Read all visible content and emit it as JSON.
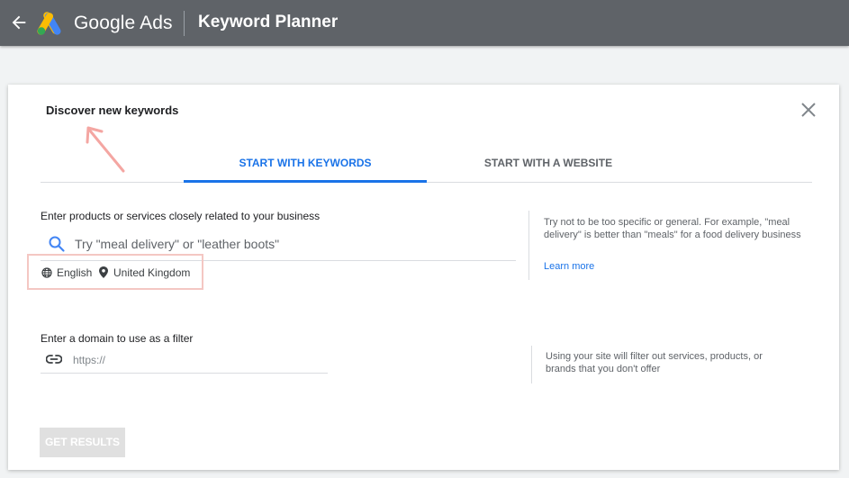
{
  "header": {
    "brand": "Google Ads",
    "title": "Keyword Planner",
    "back_icon": "arrow-left-icon",
    "logo_icon": "google-ads-logo",
    "background_color": "#5f6368"
  },
  "dialog": {
    "title": "Discover new keywords",
    "close_icon": "close-icon",
    "tabs": [
      {
        "label": "START WITH KEYWORDS",
        "active": true
      },
      {
        "label": "START WITH A WEBSITE",
        "active": false
      }
    ],
    "keywords_section": {
      "label": "Enter products or services closely related to your business",
      "input_placeholder": "Try \"meal delivery\" or \"leather boots\"",
      "input_value": "",
      "search_icon": "search-icon",
      "language": "English",
      "language_icon": "globe-icon",
      "location": "United Kingdom",
      "location_icon": "location-pin-icon",
      "tip": "Try not to be too specific or general. For example, \"meal delivery\" is better than \"meals\" for a food delivery business",
      "learn_more": "Learn more"
    },
    "domain_section": {
      "label": "Enter a domain to use as a filter",
      "input_placeholder": "https://",
      "input_value": "",
      "link_icon": "link-icon",
      "tip": "Using your site will filter out services, products, or brands that you don't offer"
    },
    "submit_label": "GET RESULTS",
    "submit_enabled": false
  },
  "colors": {
    "accent": "#1a73e8",
    "annotation": "#f4c7c3"
  }
}
